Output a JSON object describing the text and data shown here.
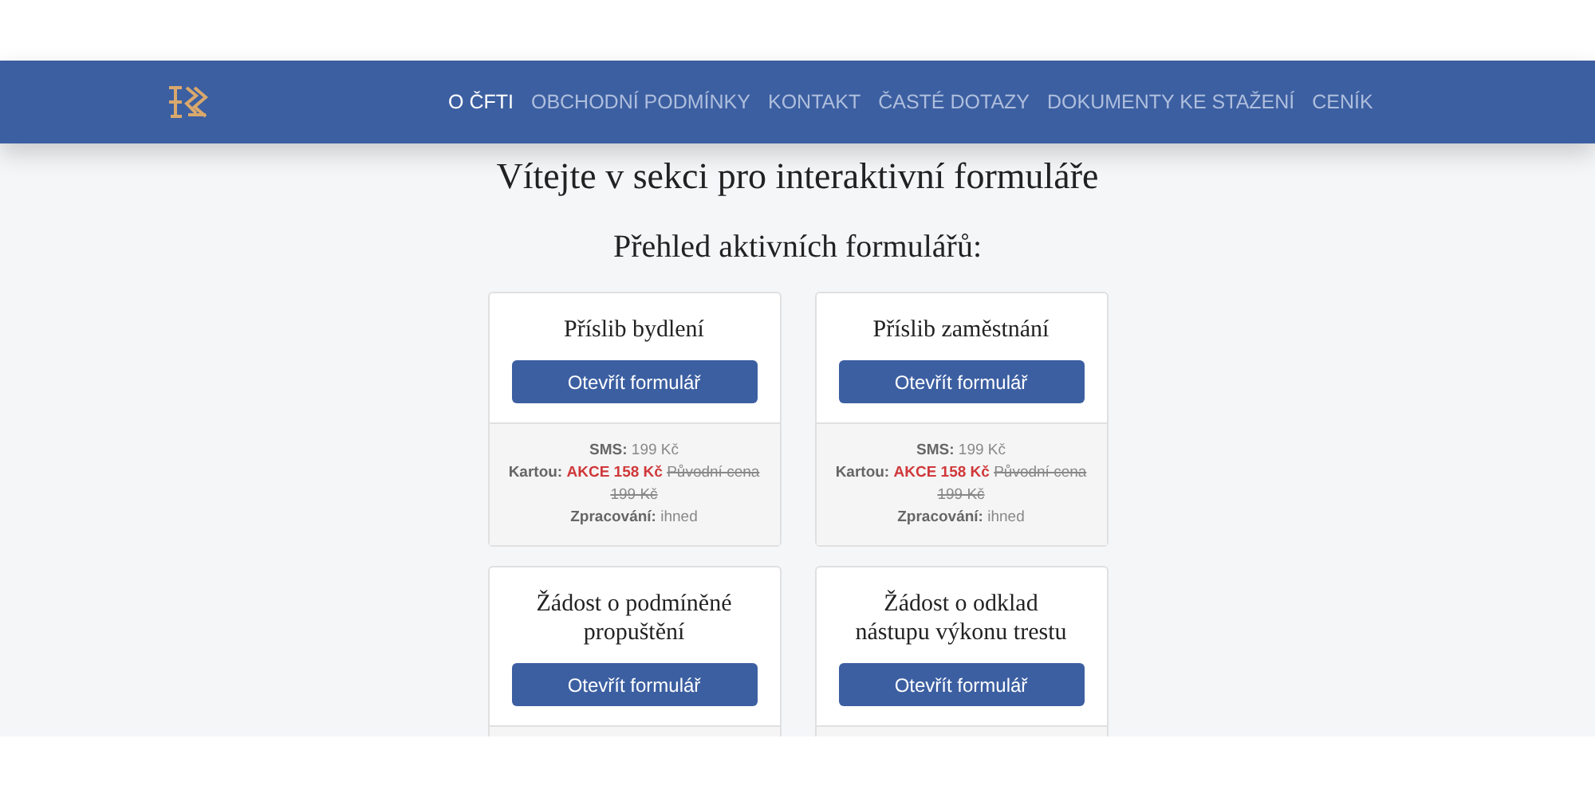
{
  "nav": {
    "items": [
      {
        "label": "O ČFTI",
        "selected": true
      },
      {
        "label": "OBCHODNÍ PODMÍNKY",
        "selected": false
      },
      {
        "label": "KONTAKT",
        "selected": false
      },
      {
        "label": "ČASTÉ DOTAZY",
        "selected": false
      },
      {
        "label": "DOKUMENTY KE STAŽENÍ",
        "selected": false
      },
      {
        "label": "CENÍK",
        "selected": false
      }
    ]
  },
  "heading": "Vítejte v sekci pro interaktivní formuláře",
  "subheading": "Přehled aktivních formulářů:",
  "forms": [
    {
      "title": "Příslib bydlení",
      "button": "Otevřít formulář",
      "prices": [
        {
          "kind": "plain",
          "label": "SMS:",
          "value": "199 Kč"
        },
        {
          "kind": "sale",
          "label": "Kartou:",
          "sale": "AKCE 158 Kč",
          "original": "Původní cena 199 Kč"
        },
        {
          "kind": "plain",
          "label": "Zpracování:",
          "value": "ihned"
        }
      ]
    },
    {
      "title": "Příslib zaměstnání",
      "button": "Otevřít formulář",
      "prices": [
        {
          "kind": "plain",
          "label": "SMS:",
          "value": "199 Kč"
        },
        {
          "kind": "sale",
          "label": "Kartou:",
          "sale": "AKCE 158 Kč",
          "original": "Původní cena 199 Kč"
        },
        {
          "kind": "plain",
          "label": "Zpracování:",
          "value": "ihned"
        }
      ]
    },
    {
      "title": "Žádost o podmíněné propuštění",
      "button": "Otevřít formulář"
    },
    {
      "title": "Žádost o odklad nástupu výkonu trestu",
      "button": "Otevřít formulář"
    }
  ]
}
